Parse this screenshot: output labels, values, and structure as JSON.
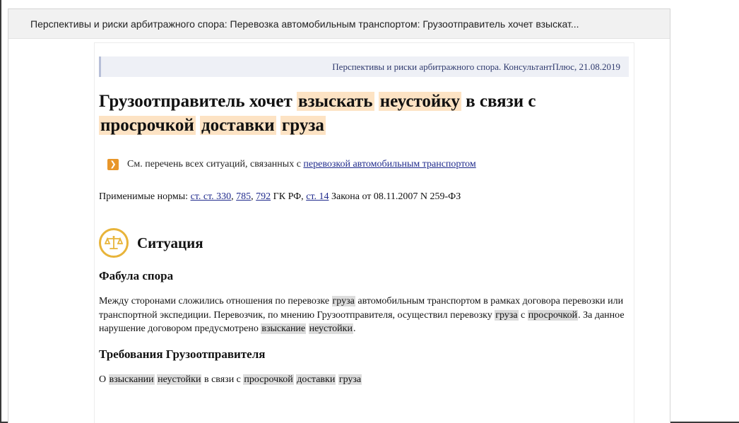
{
  "window": {
    "title": "Перспективы и риски арбитражного спора: Перевозка автомобильным транспортом: Грузоотправитель хочет взыскат..."
  },
  "source": {
    "text": "Перспективы и риски арбитражного спора. КонсультантПлюс, 21.08.2019"
  },
  "heading": {
    "part1": "Грузоотправитель хочет ",
    "hl1": "взыскать",
    "sp1": " ",
    "hl2": "неустойку",
    "part2": " в связи с ",
    "hl3": "просрочкой",
    "sp2": " ",
    "hl4": "доставки",
    "sp3": " ",
    "hl5": "груза"
  },
  "see_list": {
    "prefix": "См. перечень всех ситуаций, связанных с ",
    "link": "перевозкой автомобильным транспортом",
    "icon": "chevron-right-icon"
  },
  "norms": {
    "prefix": "Применимые нормы: ",
    "link1": "ст. ст. 330",
    "sep1": ", ",
    "link2": "785",
    "sep2": ", ",
    "link3": "792",
    "mid": " ГК РФ, ",
    "link4": "ст. 14",
    "suffix": " Закона от 08.11.2007 N 259-ФЗ"
  },
  "situation": {
    "icon": "scales-icon",
    "title": "Ситуация"
  },
  "fabula": {
    "title": "Фабула спора",
    "t1": "Между сторонами сложились отношения по перевозке ",
    "h1": "груза",
    "t2": " автомобильным транспортом в рамках договора перевозки или транспортной экспедиции. Перевозчик, по мнению Грузоотправителя, осуществил перевозку ",
    "h2": "груза",
    "t3": " с ",
    "h3": "просрочкой",
    "t4": ". За данное нарушение договором предусмотрено ",
    "h4": "взыскание",
    "t5": " ",
    "h5": "неустойки",
    "t6": "."
  },
  "demands": {
    "title": "Требования Грузоотправителя",
    "t1": "О ",
    "h1": "взыскании",
    "t2": " ",
    "h2": "неустойки",
    "t3": " в связи с ",
    "h3": "просрочкой",
    "t4": " ",
    "h4": "доставки",
    "t5": " ",
    "h5": "груза"
  },
  "colors": {
    "heading_highlight": "#fde3c4",
    "text_highlight": "#dcdcdc",
    "link": "#1f2a8c",
    "accent_orange": "#e8962a",
    "icon_gold": "#e8b43a"
  }
}
